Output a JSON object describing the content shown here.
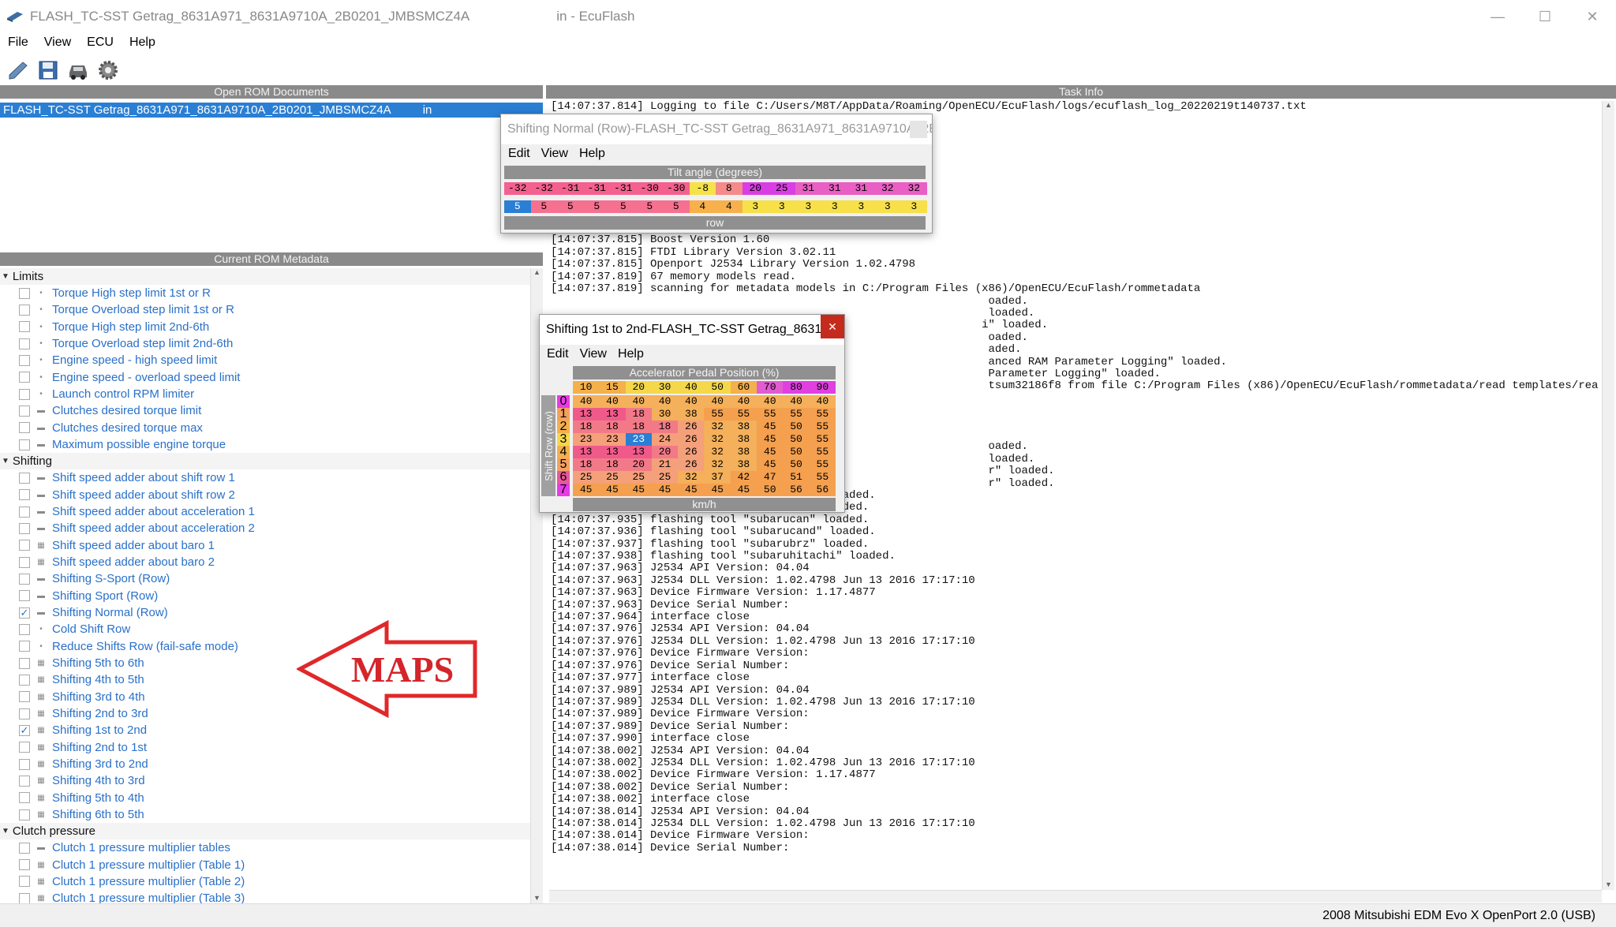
{
  "window": {
    "title": "FLASH_TC-SST Getrag_8631A971_8631A9710A_2B0201_JMBSMCZ4A",
    "title_suffix": "in - EcuFlash"
  },
  "menu": [
    "File",
    "View",
    "ECU",
    "Help"
  ],
  "panels": {
    "docs_header": "Open ROM Documents",
    "task_header": "Task Info",
    "meta_header": "Current ROM Metadata"
  },
  "open_doc": "FLASH_TC-SST Getrag_8631A971_8631A9710A_2B0201_JMBSMCZ4A",
  "open_doc_suffix": "in",
  "metadata": [
    {
      "group": "Limits",
      "items": [
        {
          "label": "Torque High step limit 1st or R",
          "icon": "dot",
          "checked": false
        },
        {
          "label": "Torque Overload step limit 1st or R",
          "icon": "dot",
          "checked": false
        },
        {
          "label": "Torque High step limit 2nd-6th",
          "icon": "dot",
          "checked": false
        },
        {
          "label": "Torque Overload step limit 2nd-6th",
          "icon": "dot",
          "checked": false
        },
        {
          "label": "Engine speed - high speed limit",
          "icon": "dot",
          "checked": false
        },
        {
          "label": "Engine speed - overload speed limit",
          "icon": "dot",
          "checked": false
        },
        {
          "label": "Launch control RPM limiter",
          "icon": "dot",
          "checked": false
        },
        {
          "label": "Clutches desired torque limit",
          "icon": "row",
          "checked": false
        },
        {
          "label": "Clutches desired torque max",
          "icon": "row",
          "checked": false
        },
        {
          "label": "Maximum possible engine torque",
          "icon": "row",
          "checked": false
        }
      ]
    },
    {
      "group": "Shifting",
      "items": [
        {
          "label": "Shift speed adder about shift row 1",
          "icon": "row",
          "checked": false
        },
        {
          "label": "Shift speed adder about shift row 2",
          "icon": "row",
          "checked": false
        },
        {
          "label": "Shift speed adder about acceleration 1",
          "icon": "row",
          "checked": false
        },
        {
          "label": "Shift speed adder about acceleration 2",
          "icon": "row",
          "checked": false
        },
        {
          "label": "Shift speed adder about baro 1",
          "icon": "grid",
          "checked": false
        },
        {
          "label": "Shift speed adder about baro 2",
          "icon": "grid",
          "checked": false
        },
        {
          "label": "Shifting S-Sport (Row)",
          "icon": "row",
          "checked": false
        },
        {
          "label": "Shifting Sport (Row)",
          "icon": "row",
          "checked": false
        },
        {
          "label": "Shifting Normal (Row)",
          "icon": "row",
          "checked": true
        },
        {
          "label": "Cold Shift Row",
          "icon": "dot",
          "checked": false
        },
        {
          "label": "Reduce Shifts Row (fail-safe mode)",
          "icon": "dot",
          "checked": false
        },
        {
          "label": "Shifting 5th to 6th",
          "icon": "grid",
          "checked": false
        },
        {
          "label": "Shifting 4th to 5th",
          "icon": "grid",
          "checked": false
        },
        {
          "label": "Shifting 3rd to 4th",
          "icon": "grid",
          "checked": false
        },
        {
          "label": "Shifting 2nd to 3rd",
          "icon": "grid",
          "checked": false
        },
        {
          "label": "Shifting 1st to 2nd",
          "icon": "grid",
          "checked": true
        },
        {
          "label": "Shifting 2nd to 1st",
          "icon": "grid",
          "checked": false
        },
        {
          "label": "Shifting 3rd to 2nd",
          "icon": "grid",
          "checked": false
        },
        {
          "label": "Shifting 4th to 3rd",
          "icon": "grid",
          "checked": false
        },
        {
          "label": "Shifting 5th to 4th",
          "icon": "grid",
          "checked": false
        },
        {
          "label": "Shifting 6th to 5th",
          "icon": "grid",
          "checked": false
        }
      ]
    },
    {
      "group": "Clutch pressure",
      "items": [
        {
          "label": "Clutch 1 pressure multiplier tables",
          "icon": "row",
          "checked": false
        },
        {
          "label": "Clutch 1 pressure multiplier (Table 1)",
          "icon": "grid",
          "checked": false
        },
        {
          "label": "Clutch 1 pressure multiplier (Table 2)",
          "icon": "grid",
          "checked": false
        },
        {
          "label": "Clutch 1 pressure multiplier (Table 3)",
          "icon": "grid",
          "checked": false
        }
      ]
    }
  ],
  "annotation": "MAPS",
  "log_lines": [
    "[14:07:37.814] Logging to file C:/Users/M8T/AppData/Roaming/OpenECU/EcuFlash/logs/ecuflash_log_20220219t140737.txt",
    "",
    "",
    "",
    "",
    "",
    "",
    "",
    "",
    "",
    "[14:07:37.815] QwtPlot3D Version 0.2.6",
    "[14:07:37.815] Boost Version 1.60",
    "[14:07:37.815] FTDI Library Version 3.02.11",
    "[14:07:37.815] Openport J2534 Library Version 1.02.4798",
    "[14:07:37.819] 67 memory models read.",
    "[14:07:37.819] scanning for metadata models in C:/Program Files (x86)/OpenECU/EcuFlash/rommetadata",
    "                                                                  oaded.",
    "                                                                  loaded.",
    "                                                                 i\" loaded.",
    "                                                                  oaded.",
    "                                                                  aded.",
    "                                                                  anced RAM Parameter Logging\" loaded.",
    "                                                                  Parameter Logging\" loaded.",
    "                                                                  tsum32186f8 from file C:/Program Files (x86)/OpenECU/EcuFlash/rommetadata/read templates/read_mitsum32186f8.xml",
    "",
    "",
    "",
    "",
    "                                                                  oaded.",
    "                                                                  loaded.",
    "                                                                  r\" loaded.",
    "                                                                  r\" loaded.",
    "[14:07:37.933] flashing tool \"shbootmode\" loaded.",
    "[14:07:37.933] flashing tool \"shaudmode\" loaded.",
    "[14:07:37.935] flashing tool \"subarucan\" loaded.",
    "[14:07:37.936] flashing tool \"subarucand\" loaded.",
    "[14:07:37.937] flashing tool \"subarubrz\" loaded.",
    "[14:07:37.938] flashing tool \"subaruhitachi\" loaded.",
    "[14:07:37.963] J2534 API Version: 04.04",
    "[14:07:37.963] J2534 DLL Version: 1.02.4798 Jun 13 2016 17:17:10",
    "[14:07:37.963] Device Firmware Version: 1.17.4877",
    "[14:07:37.963] Device Serial Number:",
    "[14:07:37.964] interface close",
    "[14:07:37.976] J2534 API Version: 04.04",
    "[14:07:37.976] J2534 DLL Version: 1.02.4798 Jun 13 2016 17:17:10",
    "[14:07:37.976] Device Firmware Version:",
    "[14:07:37.976] Device Serial Number:",
    "[14:07:37.977] interface close",
    "[14:07:37.989] J2534 API Version: 04.04",
    "[14:07:37.989] J2534 DLL Version: 1.02.4798 Jun 13 2016 17:17:10",
    "[14:07:37.989] Device Firmware Version:",
    "[14:07:37.989] Device Serial Number:",
    "[14:07:37.990] interface close",
    "[14:07:38.002] J2534 API Version: 04.04",
    "[14:07:38.002] J2534 DLL Version: 1.02.4798 Jun 13 2016 17:17:10",
    "[14:07:38.002] Device Firmware Version: 1.17.4877",
    "[14:07:38.002] Device Serial Number:",
    "[14:07:38.002] interface close",
    "[14:07:38.014] J2534 API Version: 04.04",
    "[14:07:38.014] J2534 DLL Version: 1.02.4798 Jun 13 2016 17:17:10",
    "[14:07:38.014] Device Firmware Version:",
    "[14:07:38.014] Device Serial Number:"
  ],
  "status": "2008 Mitsubishi EDM Evo X  OpenPort 2.0 (USB)",
  "popup_row": {
    "title": "Shifting Normal (Row)-FLASH_TC-SST Getrag_8631A971_8631A9710A_2B...",
    "menu": [
      "Edit",
      "View",
      "Help"
    ],
    "axis_label": "Tilt angle (degrees)",
    "axis_values": [
      "-32",
      "-32",
      "-31",
      "-31",
      "-31",
      "-30",
      "-30",
      "-8",
      "8",
      "20",
      "25",
      "31",
      "31",
      "31",
      "32",
      "32"
    ],
    "values": [
      "5",
      "5",
      "5",
      "5",
      "5",
      "5",
      "5",
      "4",
      "4",
      "3",
      "3",
      "3",
      "3",
      "3",
      "3",
      "3"
    ],
    "footer": "row"
  },
  "popup_table": {
    "title": "Shifting 1st to 2nd-FLASH_TC-SST Getrag_8631A9...",
    "menu": [
      "Edit",
      "View",
      "Help"
    ],
    "x_label": "Accelerator Pedal Position (%)",
    "y_label": "Shift Row (row)",
    "x_values": [
      "10",
      "15",
      "20",
      "30",
      "40",
      "50",
      "60",
      "70",
      "80",
      "90"
    ],
    "y_values": [
      "0",
      "1",
      "2",
      "3",
      "4",
      "5",
      "6",
      "7"
    ],
    "cells": [
      [
        "40",
        "40",
        "40",
        "40",
        "40",
        "40",
        "40",
        "40",
        "40",
        "40"
      ],
      [
        "13",
        "13",
        "18",
        "30",
        "38",
        "55",
        "55",
        "55",
        "55",
        "55"
      ],
      [
        "18",
        "18",
        "18",
        "18",
        "26",
        "32",
        "38",
        "45",
        "50",
        "55"
      ],
      [
        "23",
        "23",
        "23",
        "24",
        "26",
        "32",
        "38",
        "45",
        "50",
        "55"
      ],
      [
        "13",
        "13",
        "13",
        "20",
        "26",
        "32",
        "38",
        "45",
        "50",
        "55"
      ],
      [
        "18",
        "18",
        "20",
        "21",
        "26",
        "32",
        "38",
        "45",
        "50",
        "55"
      ],
      [
        "25",
        "25",
        "25",
        "25",
        "32",
        "37",
        "42",
        "47",
        "51",
        "55"
      ],
      [
        "45",
        "45",
        "45",
        "45",
        "45",
        "45",
        "45",
        "50",
        "56",
        "56"
      ]
    ],
    "selected": [
      3,
      2
    ],
    "footer": "km/h"
  }
}
